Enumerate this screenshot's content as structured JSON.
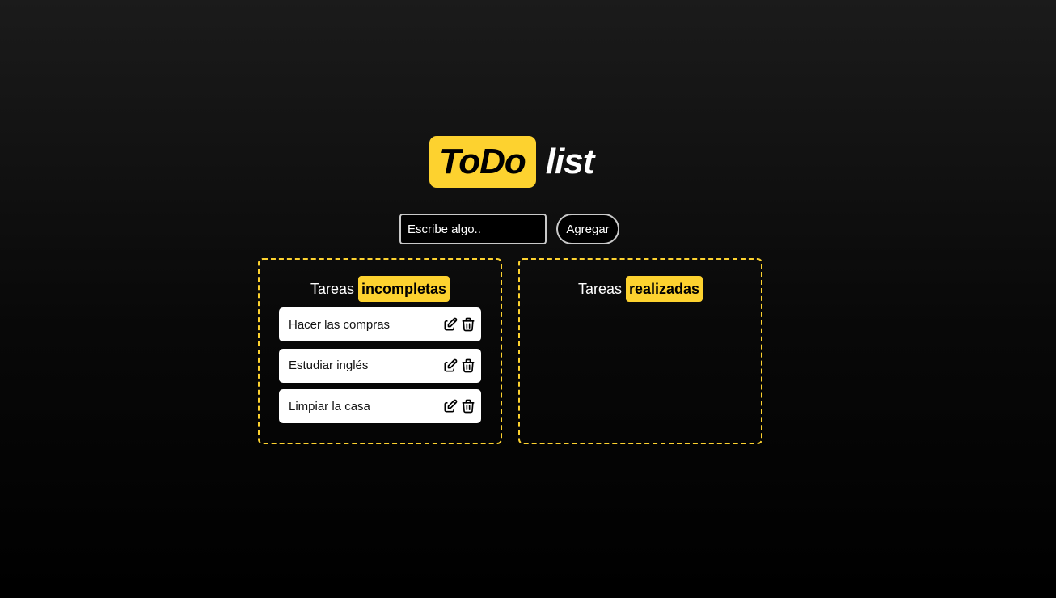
{
  "header": {
    "title_highlight": "ToDo",
    "title_rest": "list"
  },
  "form": {
    "input_placeholder": "Escribe algo..",
    "input_value": "",
    "add_label": "Agregar"
  },
  "incomplete": {
    "heading_plain": "Tareas",
    "heading_highlight": "incompletas",
    "tasks": [
      {
        "text": "Hacer las compras",
        "edit_icon": "edit-icon",
        "delete_icon": "trash-icon"
      },
      {
        "text": "Estudiar inglés",
        "edit_icon": "edit-icon",
        "delete_icon": "trash-icon"
      },
      {
        "text": "Limpiar la casa",
        "edit_icon": "edit-icon",
        "delete_icon": "trash-icon"
      }
    ]
  },
  "done": {
    "heading_plain": "Tareas",
    "heading_highlight": "realizadas",
    "tasks": []
  },
  "colors": {
    "accent": "#fdd22f",
    "background_top": "#1b1b1b",
    "background_bottom": "#000000",
    "card": "#ffffff"
  }
}
